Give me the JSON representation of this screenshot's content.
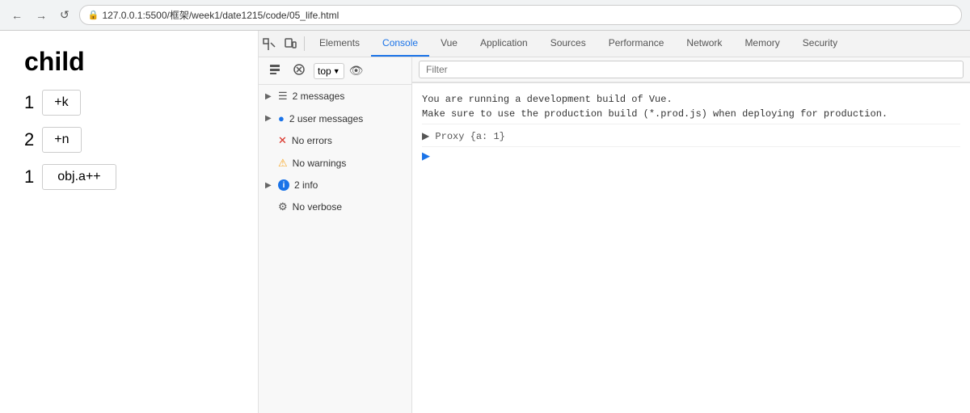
{
  "browser": {
    "url": "127.0.0.1:5500/框架/week1/date1215/code/05_life.html",
    "back_label": "←",
    "forward_label": "→",
    "reload_label": "↺"
  },
  "page": {
    "title": "child",
    "counters": [
      {
        "num": "1",
        "btn": "+k"
      },
      {
        "num": "2",
        "btn": "+n"
      },
      {
        "num": "1",
        "btn": "obj.a++"
      }
    ]
  },
  "devtools": {
    "tabs": [
      {
        "label": "Elements"
      },
      {
        "label": "Console",
        "active": true
      },
      {
        "label": "Vue"
      },
      {
        "label": "Application"
      },
      {
        "label": "Sources"
      },
      {
        "label": "Performance"
      },
      {
        "label": "Network"
      },
      {
        "label": "Memory"
      },
      {
        "label": "Security"
      }
    ],
    "toolbar": {
      "top_label": "top",
      "filter_placeholder": "Filter"
    },
    "sidebar": {
      "items": [
        {
          "icon": "list",
          "label": "2 messages",
          "has_arrow": true
        },
        {
          "icon": "user",
          "label": "2 user messages",
          "has_arrow": true
        },
        {
          "icon": "error",
          "label": "No errors",
          "has_arrow": false
        },
        {
          "icon": "warning",
          "label": "No warnings",
          "has_arrow": false
        },
        {
          "icon": "info",
          "label": "2 info",
          "has_arrow": true
        },
        {
          "icon": "verbose",
          "label": "No verbose",
          "has_arrow": false
        }
      ]
    },
    "console": {
      "messages": [
        {
          "text": "You are running a development build of Vue.\nMake sure to use the production build (*.prod.js) when deploying for production."
        }
      ],
      "proxy_line": "▶ Proxy {a: 1}"
    }
  }
}
